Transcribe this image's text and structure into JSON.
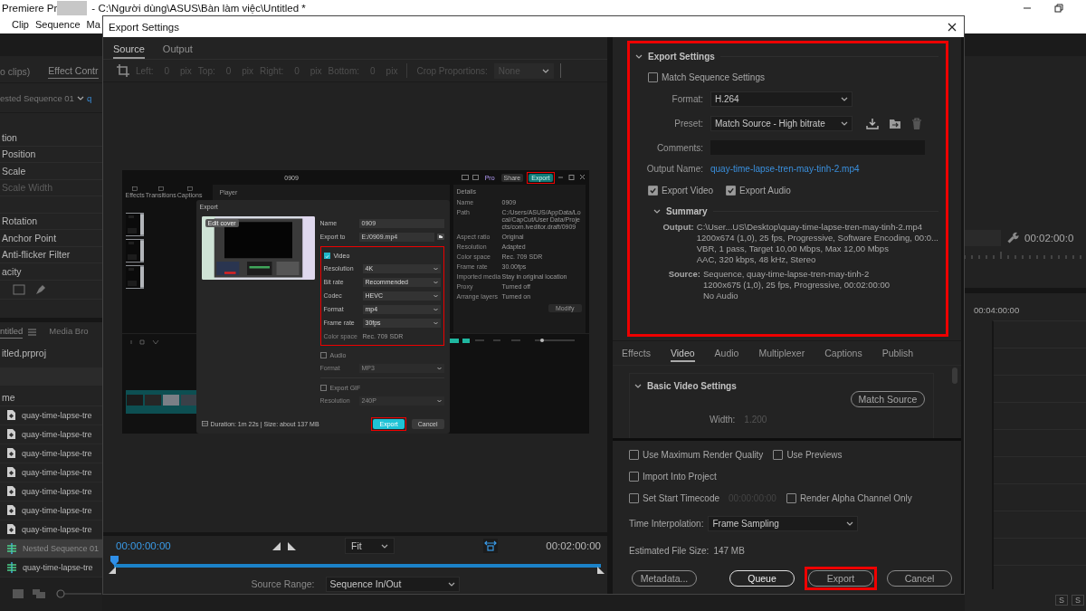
{
  "titlebar": {
    "app": "Premiere Pr",
    "path": "- C:\\Người dùng\\ASUS\\Bàn làm việc\\Untitled *"
  },
  "menu": [
    "Clip",
    "Sequence",
    "Ma"
  ],
  "left_panel": {
    "tabs": [
      {
        "label": "o clips)",
        "selected": false
      },
      {
        "label": "Effect Contr",
        "selected": true
      }
    ],
    "sequence": "ested Sequence 01",
    "clip": "q",
    "properties": [
      {
        "label": "tion",
        "disabled": false
      },
      {
        "label": "Position",
        "disabled": false
      },
      {
        "label": "Scale",
        "disabled": false
      },
      {
        "label": "Scale Width",
        "disabled": true
      },
      {
        "label": "Rotation",
        "disabled": false
      },
      {
        "label": "Anchor Point",
        "disabled": false
      },
      {
        "label": "Anti-flicker Filter",
        "disabled": false
      },
      {
        "label": "acity",
        "disabled": false
      }
    ],
    "project_tabs": [
      {
        "label": "ntitled",
        "selected": true
      },
      {
        "label": "Media Bro",
        "selected": false
      }
    ],
    "project_file": "itled.prproj",
    "column": "me",
    "items": [
      {
        "name": "quay-time-lapse-tre",
        "kind": "clip",
        "selected": false
      },
      {
        "name": "quay-time-lapse-tre",
        "kind": "clip",
        "selected": false
      },
      {
        "name": "quay-time-lapse-tre",
        "kind": "clip",
        "selected": false
      },
      {
        "name": "quay-time-lapse-tre",
        "kind": "clip",
        "selected": false
      },
      {
        "name": "quay-time-lapse-tre",
        "kind": "clip",
        "selected": false
      },
      {
        "name": "quay-time-lapse-tre",
        "kind": "clip",
        "selected": false
      },
      {
        "name": "quay-time-lapse-tre",
        "kind": "clip",
        "selected": false
      },
      {
        "name": "Nested Sequence 01",
        "kind": "sequence",
        "selected": true
      },
      {
        "name": "quay-time-lapse-tre",
        "kind": "sequence",
        "selected": false
      }
    ]
  },
  "right_panel": {
    "timecode": "00:02:00:0",
    "ruler_time": "00:04:00:00",
    "track_buttons": [
      "S",
      "S"
    ]
  },
  "dialog": {
    "title": "Export Settings",
    "tabs": [
      {
        "label": "Source",
        "selected": true
      },
      {
        "label": "Output",
        "selected": false
      }
    ],
    "crop": {
      "fields": [
        {
          "label": "Left:",
          "value": "0",
          "unit": "pix"
        },
        {
          "label": "Top:",
          "value": "0",
          "unit": "pix"
        },
        {
          "label": "Right:",
          "value": "0",
          "unit": "pix"
        },
        {
          "label": "Bottom:",
          "value": "0",
          "unit": "pix"
        }
      ],
      "proportions_label": "Crop Proportions:",
      "proportions_value": "None"
    },
    "preview": {
      "title": "0909",
      "buttons": [
        {
          "label": "Pro",
          "kind": "pro",
          "highlighted": false
        },
        {
          "label": "Share",
          "kind": "share",
          "highlighted": false
        },
        {
          "label": "Export",
          "kind": "export",
          "highlighted": true
        }
      ],
      "tools": [
        "Effects",
        "Transitions",
        "Captions"
      ],
      "player": "Player",
      "details_title": "Details",
      "details": [
        {
          "label": "Name",
          "value": "0909"
        },
        {
          "label": "Path",
          "value": "C:/Users/ASUS/AppData/Local/CapCut/User Data/Projects/com.lveditor.draft/0909"
        },
        {
          "label": "Aspect ratio",
          "value": "Original"
        },
        {
          "label": "Resolution",
          "value": "Adapted"
        },
        {
          "label": "Color space",
          "value": "Rec. 709 SDR"
        },
        {
          "label": "Frame rate",
          "value": "30.00fps"
        },
        {
          "label": "Imported media",
          "value": "Stay in original location"
        },
        {
          "label": "Proxy",
          "value": "Turned off"
        },
        {
          "label": "Arrange layers",
          "value": "Turned on"
        }
      ],
      "modify": "Modify",
      "export": {
        "title": "Export",
        "cover": "Edit cover",
        "fields": [
          {
            "label": "Name",
            "value": "0909",
            "kind": "text"
          },
          {
            "label": "Export to",
            "value": "E:/0909.mp4",
            "kind": "path"
          }
        ],
        "sections": [
          {
            "label": "Video",
            "checked": true,
            "highlighted": true,
            "rows": [
              {
                "label": "Resolution",
                "value": "4K",
                "kind": "select"
              },
              {
                "label": "Bit rate",
                "value": "Recommended",
                "kind": "select"
              },
              {
                "label": "Codec",
                "value": "HEVC",
                "kind": "select"
              },
              {
                "label": "Format",
                "value": "mp4",
                "kind": "select"
              },
              {
                "label": "Frame rate",
                "value": "30fps",
                "kind": "select"
              },
              {
                "label": "Color space",
                "value": "Rec. 709 SDR",
                "kind": "static"
              }
            ]
          },
          {
            "label": "Audio",
            "checked": false,
            "highlighted": false,
            "rows": [
              {
                "label": "Format",
                "value": "MP3",
                "kind": "select"
              }
            ]
          },
          {
            "label": "Export GIF",
            "checked": false,
            "highlighted": false,
            "rows": [
              {
                "label": "Resolution",
                "value": "240P",
                "kind": "select"
              }
            ]
          }
        ],
        "summary": "Duration: 1m 22s | Size: about 137 MB",
        "buttons": [
          {
            "label": "Export",
            "kind": "primary",
            "highlighted": true
          },
          {
            "label": "Cancel",
            "kind": "secondary",
            "highlighted": false
          }
        ]
      }
    },
    "timeline": {
      "current": "00:00:00:00",
      "zoom": "Fit",
      "duration": "00:02:00:00",
      "level": 0,
      "range_label": "Source Range:",
      "range_value": "Sequence In/Out"
    },
    "settings": {
      "heading": "Export Settings",
      "highlighted": true,
      "match_sequence": {
        "label": "Match Sequence Settings",
        "checked": false
      },
      "fields": [
        {
          "label": "Format:",
          "value": "H.264",
          "kind": "select"
        },
        {
          "label": "Preset:",
          "value": "Match Source - High bitrate",
          "kind": "preset"
        },
        {
          "label": "Comments:",
          "kind": "input"
        },
        {
          "label": "Output Name:",
          "value": "quay-time-lapse-tren-may-tinh-2.mp4",
          "kind": "link"
        }
      ],
      "exports": [
        {
          "label": "Export Video",
          "checked": true
        },
        {
          "label": "Export Audio",
          "checked": true
        }
      ],
      "summary": {
        "heading": "Summary",
        "groups": [
          {
            "label": "Output:",
            "lines": [
              "C:\\User...US\\Desktop\\quay-time-lapse-tren-may-tinh-2.mp4",
              "1200x674 (1,0), 25 fps, Progressive, Software Encoding, 00:0...",
              "VBR, 1 pass, Target 10,00 Mbps, Max 12,00 Mbps",
              "AAC, 320 kbps, 48 kHz, Stereo"
            ]
          },
          {
            "label": "Source:",
            "lines": [
              "Sequence, quay-time-lapse-tren-may-tinh-2",
              "1200x675 (1,0), 25 fps, Progressive, 00:02:00:00",
              "No Audio"
            ]
          }
        ]
      }
    },
    "output_tabs": [
      {
        "label": "Effects",
        "selected": false
      },
      {
        "label": "Video",
        "selected": true
      },
      {
        "label": "Audio",
        "selected": false
      },
      {
        "label": "Multiplexer",
        "selected": false
      },
      {
        "label": "Captions",
        "selected": false
      },
      {
        "label": "Publish",
        "selected": false
      }
    ],
    "video_settings": {
      "heading": "Basic Video Settings",
      "match_button": "Match Source",
      "width_label": "Width:",
      "width_value": "1.200"
    },
    "options": [
      [
        {
          "label": "Use Maximum Render Quality",
          "checked": false
        },
        {
          "label": "Use Previews",
          "checked": false
        }
      ],
      [
        {
          "label": "Import Into Project",
          "checked": false
        }
      ],
      [
        {
          "label": "Set Start Timecode",
          "checked": false,
          "value": "00:00:00:00"
        },
        {
          "label": "Render Alpha Channel Only",
          "checked": false
        }
      ]
    ],
    "interpolation": {
      "label": "Time Interpolation:",
      "value": "Frame Sampling"
    },
    "file_size": {
      "label": "Estimated File Size:",
      "value": "147 MB"
    },
    "buttons": [
      {
        "label": "Metadata...",
        "kind": "metadata",
        "highlighted": false
      },
      {
        "label": "Queue",
        "kind": "queue",
        "highlighted": false
      },
      {
        "label": "Export",
        "kind": "export",
        "highlighted": true
      },
      {
        "label": "Cancel",
        "kind": "cancel",
        "highlighted": false
      }
    ]
  }
}
